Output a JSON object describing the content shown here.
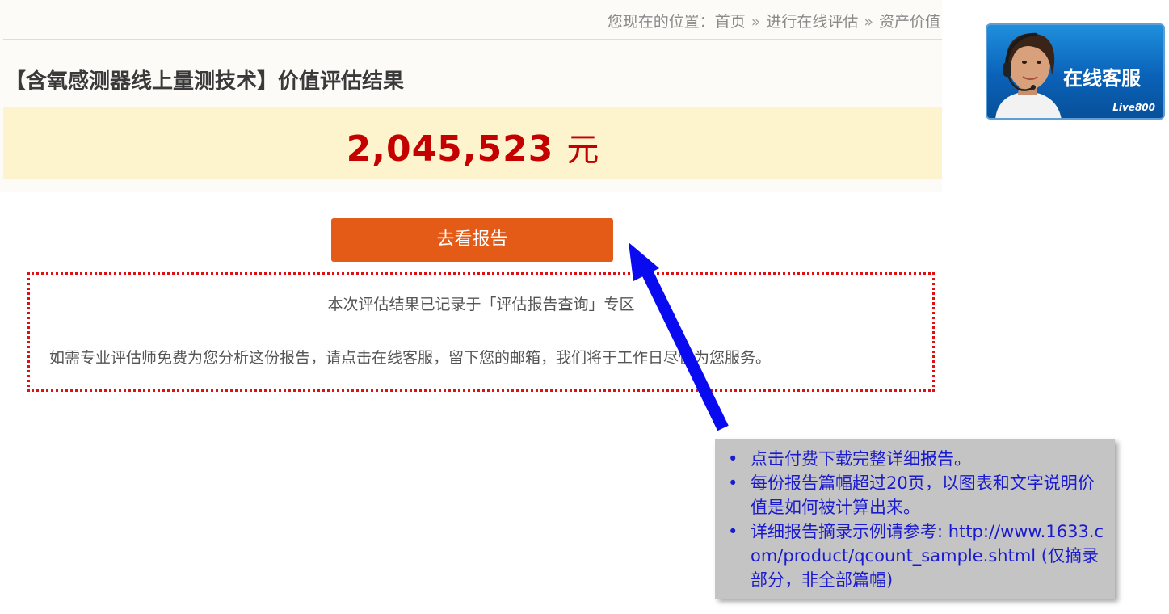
{
  "breadcrumb": {
    "prefix": "您现在的位置：",
    "items": [
      "首页",
      "进行在线评估",
      "资产价值"
    ],
    "separator": "»"
  },
  "page": {
    "title": "【含氧感测器线上量测技术】价值评估结果"
  },
  "valuation": {
    "amount": "2,045,523",
    "unit": "元"
  },
  "actions": {
    "report_button": "去看报告"
  },
  "notice": {
    "line1": "本次评估结果已记录于「评估报告查询」专区",
    "line2": "如需专业评估师免费为您分析这份报告，请点击在线客服，留下您的邮箱，我们将于工作日尽快为您服务。"
  },
  "service_widget": {
    "label": "在线客服",
    "brand": "Live800"
  },
  "callout": {
    "items": [
      "点击付费下载完整详细报告。",
      "每份报告篇幅超过20页，以图表和文字说明价值是如何被计算出来。",
      "详细报告摘录示例请参考: http://www.1633.com/product/qcount_sample.shtml (仅摘录部分，非全部篇幅)"
    ]
  },
  "colors": {
    "accent_orange": "#e45a17",
    "value_red": "#c40000",
    "callout_text": "#1a1ad0",
    "arrow_blue": "#0a0af0"
  }
}
